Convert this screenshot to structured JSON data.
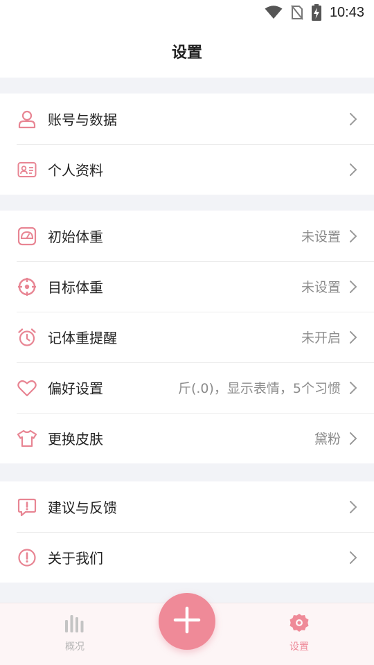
{
  "status_bar": {
    "time": "10:43"
  },
  "header": {
    "title": "设置"
  },
  "groups": {
    "account": [
      {
        "label": "账号与数据",
        "value": ""
      },
      {
        "label": "个人资料",
        "value": ""
      }
    ],
    "weight": [
      {
        "label": "初始体重",
        "value": "未设置"
      },
      {
        "label": "目标体重",
        "value": "未设置"
      },
      {
        "label": "记体重提醒",
        "value": "未开启"
      },
      {
        "label": "偏好设置",
        "value": "斤(.0)，显示表情，5个习惯"
      },
      {
        "label": "更换皮肤",
        "value": "黛粉"
      }
    ],
    "support": [
      {
        "label": "建议与反馈",
        "value": ""
      },
      {
        "label": "关于我们",
        "value": ""
      }
    ]
  },
  "bottom_nav": {
    "overview_label": "概况",
    "settings_label": "设置",
    "active": "settings"
  },
  "colors": {
    "accent": "#ef8a98",
    "icon": "#e88593",
    "value_text": "#8c8c8c",
    "background": "#f2f3f7"
  }
}
